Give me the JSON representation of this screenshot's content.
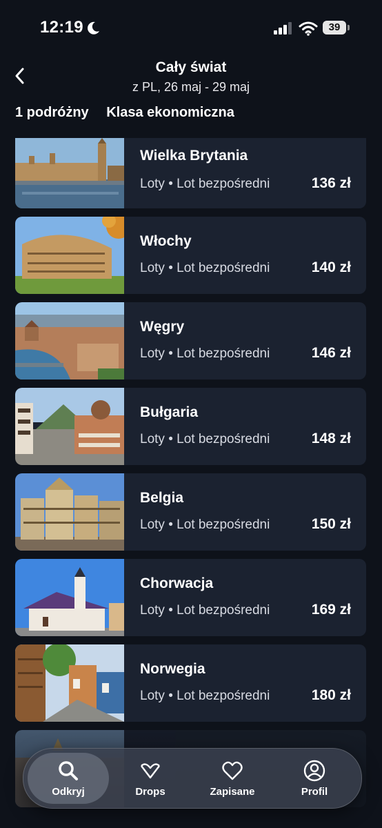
{
  "status_bar": {
    "time": "12:19",
    "battery": "39"
  },
  "header": {
    "title": "Cały świat",
    "subtitle": "z PL, 26 maj - 29 maj",
    "travelers": "1 podróżny",
    "cabin_class": "Klasa ekonomiczna"
  },
  "results": [
    {
      "country": "Wielka Brytania",
      "meta": "Loty • Lot bezpośredni",
      "price": "136 zł"
    },
    {
      "country": "Włochy",
      "meta": "Loty • Lot bezpośredni",
      "price": "140 zł"
    },
    {
      "country": "Węgry",
      "meta": "Loty • Lot bezpośredni",
      "price": "146 zł"
    },
    {
      "country": "Bułgaria",
      "meta": "Loty • Lot bezpośredni",
      "price": "148 zł"
    },
    {
      "country": "Belgia",
      "meta": "Loty • Lot bezpośredni",
      "price": "150 zł"
    },
    {
      "country": "Chorwacja",
      "meta": "Loty • Lot bezpośredni",
      "price": "169 zł"
    },
    {
      "country": "Norwegia",
      "meta": "Loty • Lot bezpośredni",
      "price": "180 zł"
    }
  ],
  "nav": {
    "discover": "Odkryj",
    "drops": "Drops",
    "saved": "Zapisane",
    "profile": "Profil"
  },
  "icons": {
    "back": "chevron-left-icon",
    "discover": "search-icon",
    "drops": "heart-outline-icon",
    "saved": "heart-icon",
    "profile": "user-icon"
  }
}
